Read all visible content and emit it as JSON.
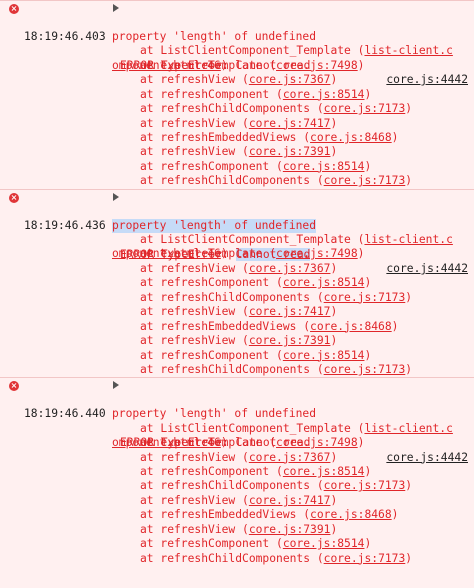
{
  "entries": [
    {
      "timestamp": "18:19:46.403",
      "message_prefix": "ERROR TypeError: ",
      "message_mid": "Cannot read",
      "message_line2": "property 'length' of undefined",
      "source": "core.js:4442",
      "stack_first": {
        "fn": "ListClientComponent_Template",
        "loc1": "list-client.c",
        "loc2": "omponent.html:46"
      },
      "stack": [
        {
          "fn": "executeTemplate",
          "loc": "core.js:7498"
        },
        {
          "fn": "refreshView",
          "loc": "core.js:7367"
        },
        {
          "fn": "refreshComponent",
          "loc": "core.js:8514"
        },
        {
          "fn": "refreshChildComponents",
          "loc": "core.js:7173"
        },
        {
          "fn": "refreshView",
          "loc": "core.js:7417"
        },
        {
          "fn": "refreshEmbeddedViews",
          "loc": "core.js:8468"
        },
        {
          "fn": "refreshView",
          "loc": "core.js:7391"
        },
        {
          "fn": "refreshComponent",
          "loc": "core.js:8514"
        },
        {
          "fn": "refreshChildComponents",
          "loc": "core.js:7173"
        }
      ]
    },
    {
      "timestamp": "18:19:46.436",
      "message_prefix": "ERROR TypeError: ",
      "message_mid": "Cannot read",
      "message_line2": "property 'length' of undefined",
      "source": "core.js:4442",
      "stack_first": {
        "fn": "ListClientComponent_Template",
        "loc1": "list-client.c",
        "loc2": "omponent.html:46"
      },
      "stack": [
        {
          "fn": "executeTemplate",
          "loc": "core.js:7498"
        },
        {
          "fn": "refreshView",
          "loc": "core.js:7367"
        },
        {
          "fn": "refreshComponent",
          "loc": "core.js:8514"
        },
        {
          "fn": "refreshChildComponents",
          "loc": "core.js:7173"
        },
        {
          "fn": "refreshView",
          "loc": "core.js:7417"
        },
        {
          "fn": "refreshEmbeddedViews",
          "loc": "core.js:8468"
        },
        {
          "fn": "refreshView",
          "loc": "core.js:7391"
        },
        {
          "fn": "refreshComponent",
          "loc": "core.js:8514"
        },
        {
          "fn": "refreshChildComponents",
          "loc": "core.js:7173"
        }
      ]
    },
    {
      "timestamp": "18:19:46.440",
      "message_prefix": "ERROR TypeError: ",
      "message_mid": "Cannot read",
      "message_line2": "property 'length' of undefined",
      "source": "core.js:4442",
      "stack_first": {
        "fn": "ListClientComponent_Template",
        "loc1": "list-client.c",
        "loc2": "omponent.html:46"
      },
      "stack": [
        {
          "fn": "executeTemplate",
          "loc": "core.js:7498"
        },
        {
          "fn": "refreshView",
          "loc": "core.js:7367"
        },
        {
          "fn": "refreshComponent",
          "loc": "core.js:8514"
        },
        {
          "fn": "refreshChildComponents",
          "loc": "core.js:7173"
        },
        {
          "fn": "refreshView",
          "loc": "core.js:7417"
        },
        {
          "fn": "refreshEmbeddedViews",
          "loc": "core.js:8468"
        },
        {
          "fn": "refreshView",
          "loc": "core.js:7391"
        },
        {
          "fn": "refreshComponent",
          "loc": "core.js:8514"
        },
        {
          "fn": "refreshChildComponents",
          "loc": "core.js:7173"
        }
      ]
    }
  ],
  "highlighted_entry": 1,
  "icons": {
    "error": "error-circle-icon",
    "expand": "expand-triangle-icon"
  },
  "colors": {
    "background": "#fff0f0",
    "error_text": "#e0262a",
    "badge": "#e03538",
    "selection": "#c6dbf7"
  }
}
